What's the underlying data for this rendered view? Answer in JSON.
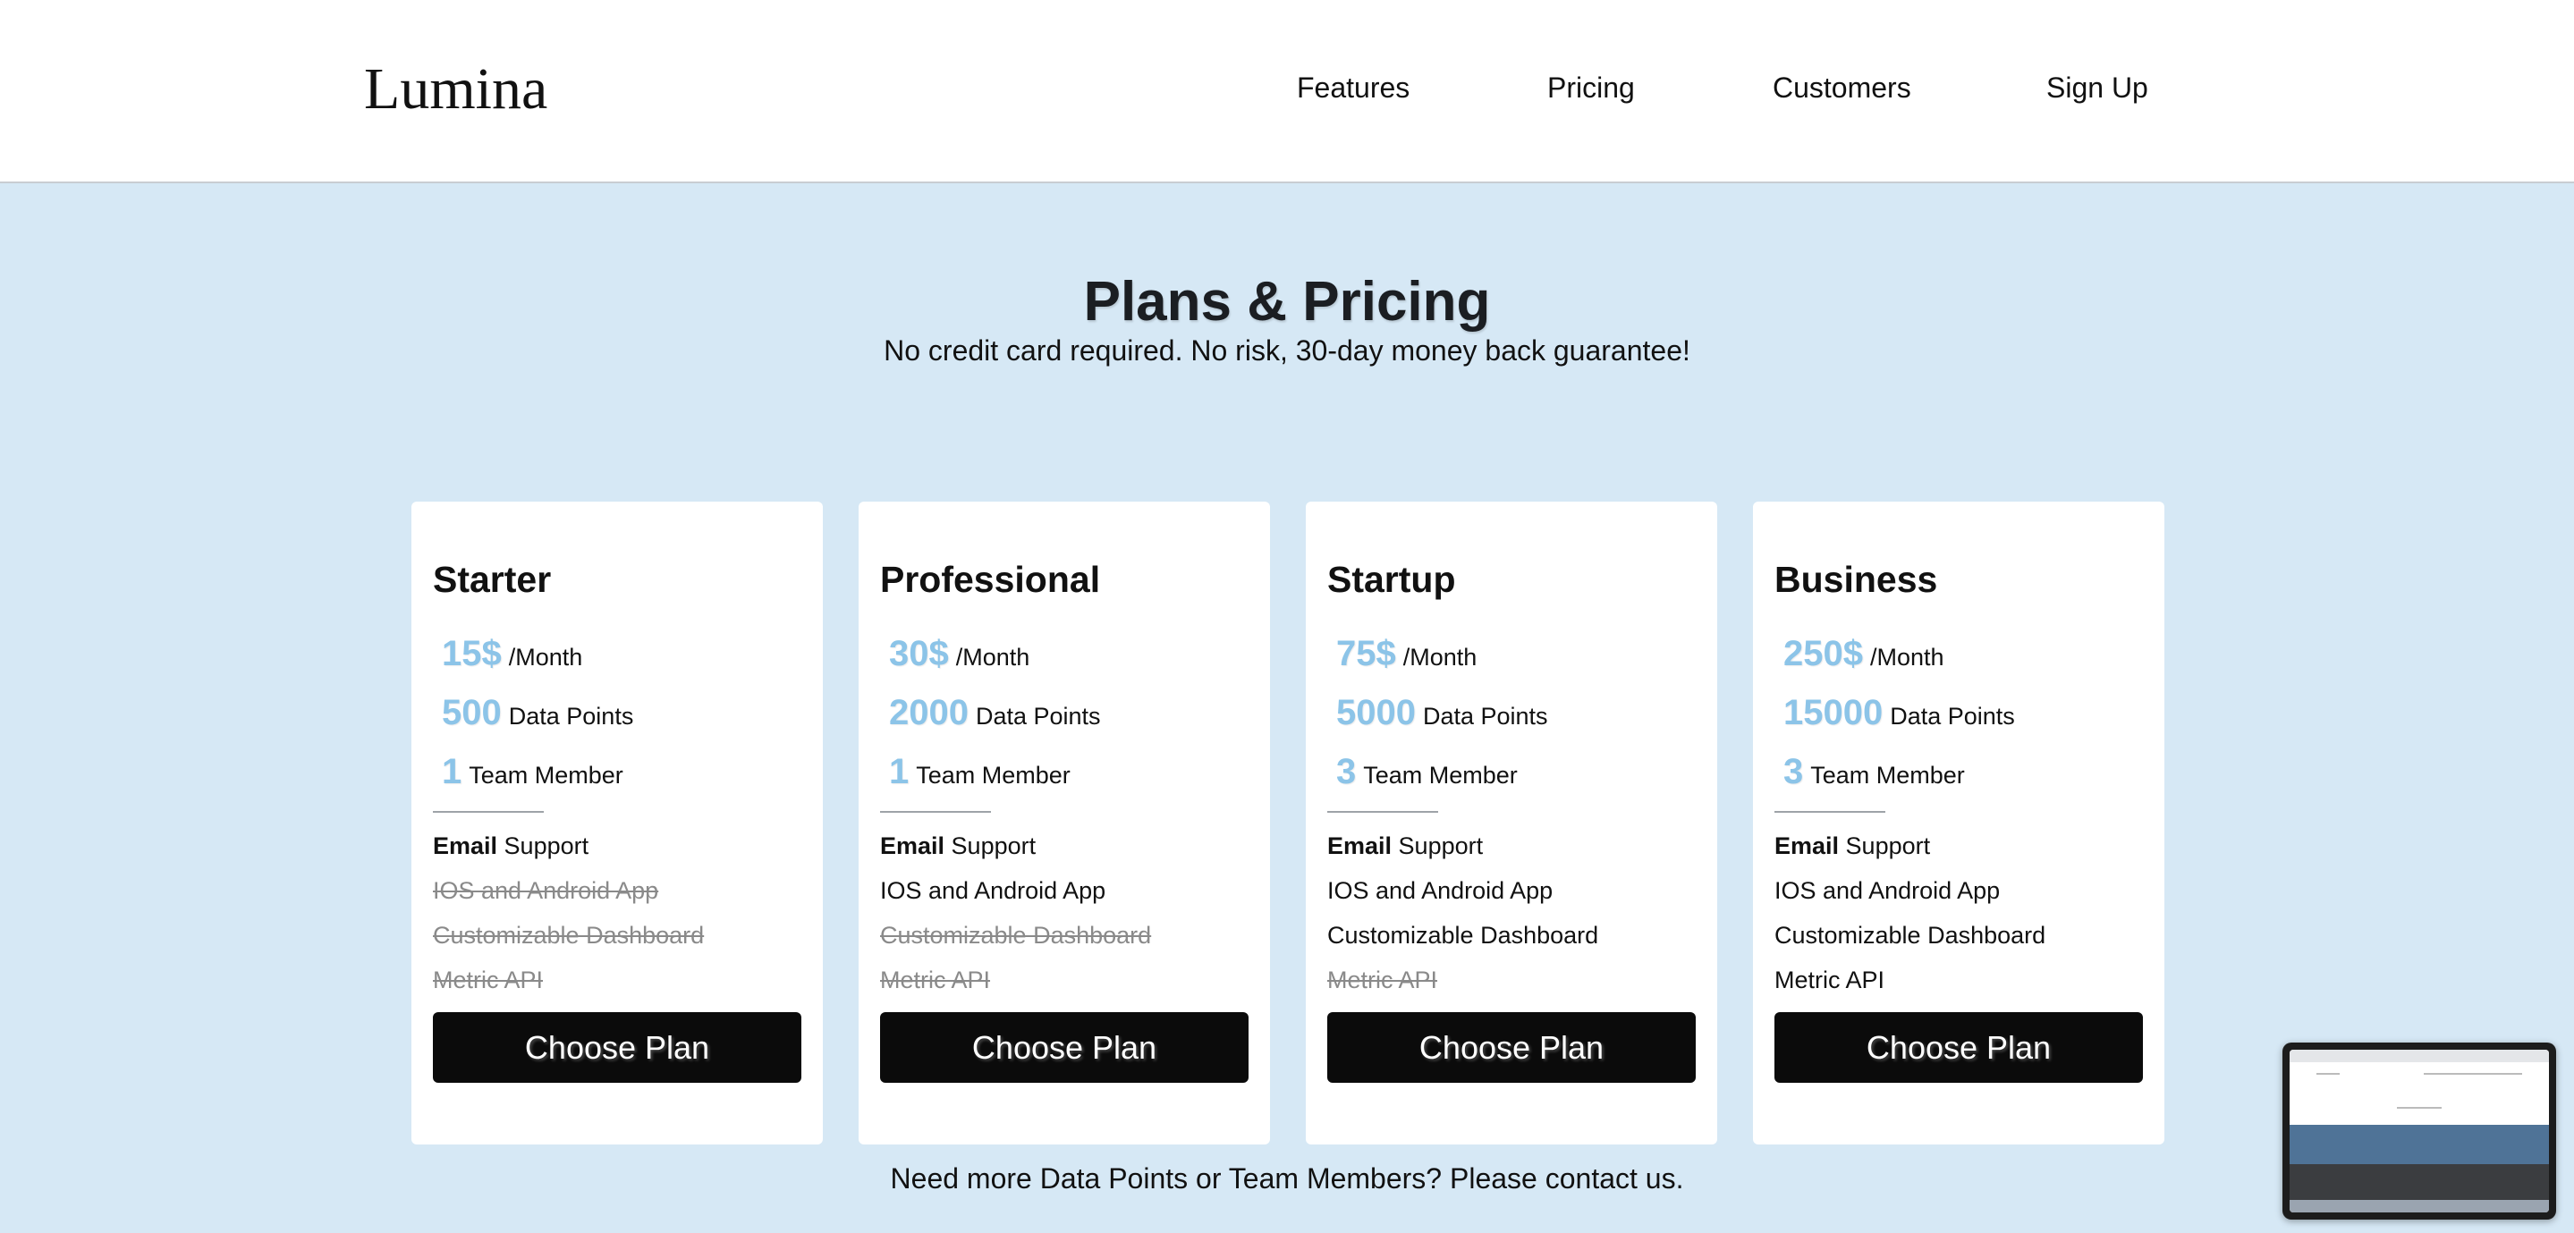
{
  "header": {
    "logo": "Lumina",
    "nav": [
      {
        "label": "Features"
      },
      {
        "label": "Pricing"
      },
      {
        "label": "Customers"
      },
      {
        "label": "Sign Up"
      }
    ]
  },
  "hero": {
    "title": "Plans & Pricing",
    "subtitle": "No credit card required. No risk, 30-day money back guarantee!"
  },
  "plans": [
    {
      "name": "Starter",
      "price": "15$",
      "price_unit": "/Month",
      "data_points": "500",
      "data_points_label": "Data Points",
      "team": "1",
      "team_label": "Team Member",
      "support_bold": "Email",
      "support_rest": " Support",
      "features": [
        {
          "label": "IOS and Android App",
          "included": false
        },
        {
          "label": "Customizable Dashboard",
          "included": false
        },
        {
          "label": "Metric API",
          "included": false
        }
      ],
      "button": "Choose Plan"
    },
    {
      "name": "Professional",
      "price": "30$",
      "price_unit": "/Month",
      "data_points": "2000",
      "data_points_label": "Data Points",
      "team": "1",
      "team_label": "Team Member",
      "support_bold": "Email",
      "support_rest": " Support",
      "features": [
        {
          "label": "IOS and Android App",
          "included": true
        },
        {
          "label": "Customizable Dashboard",
          "included": false
        },
        {
          "label": "Metric API",
          "included": false
        }
      ],
      "button": "Choose Plan"
    },
    {
      "name": "Startup",
      "price": "75$",
      "price_unit": "/Month",
      "data_points": "5000",
      "data_points_label": "Data Points",
      "team": "3",
      "team_label": "Team Member",
      "support_bold": "Email",
      "support_rest": " Support",
      "features": [
        {
          "label": "IOS and Android App",
          "included": true
        },
        {
          "label": "Customizable Dashboard",
          "included": true
        },
        {
          "label": "Metric API",
          "included": false
        }
      ],
      "button": "Choose Plan"
    },
    {
      "name": "Business",
      "price": "250$",
      "price_unit": "/Month",
      "data_points": "15000",
      "data_points_label": "Data Points",
      "team": "3",
      "team_label": "Team Member",
      "support_bold": "Email",
      "support_rest": " Support",
      "features": [
        {
          "label": "IOS and Android App",
          "included": true
        },
        {
          "label": "Customizable Dashboard",
          "included": true
        },
        {
          "label": "Metric API",
          "included": true
        }
      ],
      "button": "Choose Plan"
    }
  ],
  "footer": {
    "note": "Need more Data Points or Team Members? Please ",
    "link": "contact us",
    "end": "."
  },
  "colors": {
    "page_bg": "#d6e8f5",
    "accent_number": "#8cc4e8",
    "button_bg": "#0b0b0b"
  }
}
